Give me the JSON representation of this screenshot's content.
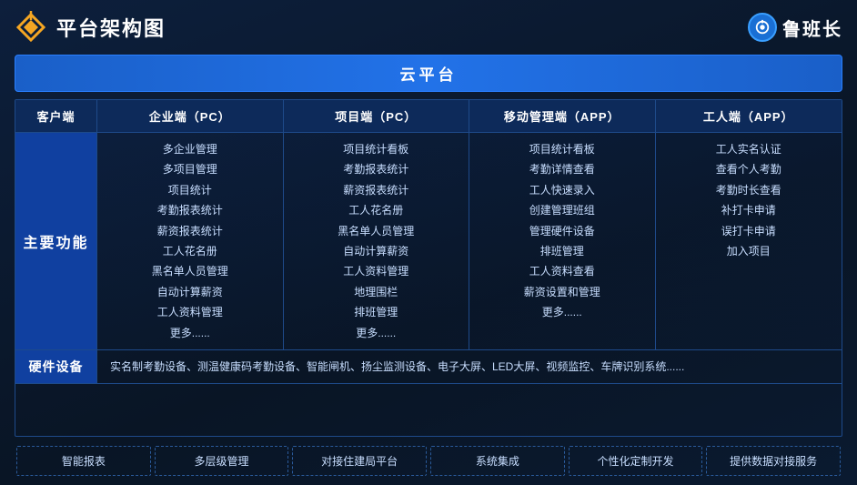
{
  "header": {
    "title": "平台架构图",
    "brand_name": "鲁班长"
  },
  "cloud_banner": "云平台",
  "col_headers": {
    "client": "客户端",
    "enterprise_pc": "企业端（PC）",
    "project_pc": "项目端（PC）",
    "mobile_app": "移动管理端（APP）",
    "worker_app": "工人端（APP）"
  },
  "main_row": {
    "label": "主要功能",
    "enterprise_features": [
      "多企业管理",
      "多项目管理",
      "项目统计",
      "考勤报表统计",
      "薪资报表统计",
      "工人花名册",
      "黑名单人员管理",
      "自动计算薪资",
      "工人资料管理",
      "更多......"
    ],
    "project_features": [
      "项目统计看板",
      "考勤报表统计",
      "薪资报表统计",
      "工人花名册",
      "黑名单人员管理",
      "自动计算薪资",
      "工人资料管理",
      "地理围栏",
      "排班管理",
      "更多......"
    ],
    "mobile_features": [
      "项目统计看板",
      "考勤详情查看",
      "工人快速录入",
      "创建管理班组",
      "管理硬件设备",
      "排班管理",
      "工人资料查看",
      "薪资设置和管理",
      "更多......"
    ],
    "worker_features": [
      "工人实名认证",
      "查看个人考勤",
      "考勤时长查看",
      "补打卡申请",
      "误打卡申请",
      "加入项目"
    ]
  },
  "hardware_row": {
    "label": "硬件设备",
    "content": "实名制考勤设备、测温健康码考勤设备、智能闸机、扬尘监测设备、电子大屏、LED大屏、视频监控、车牌识别系统......"
  },
  "features": [
    "智能报表",
    "多层级管理",
    "对接住建局平台",
    "系统集成",
    "个性化定制开发",
    "提供数据对接服务"
  ]
}
